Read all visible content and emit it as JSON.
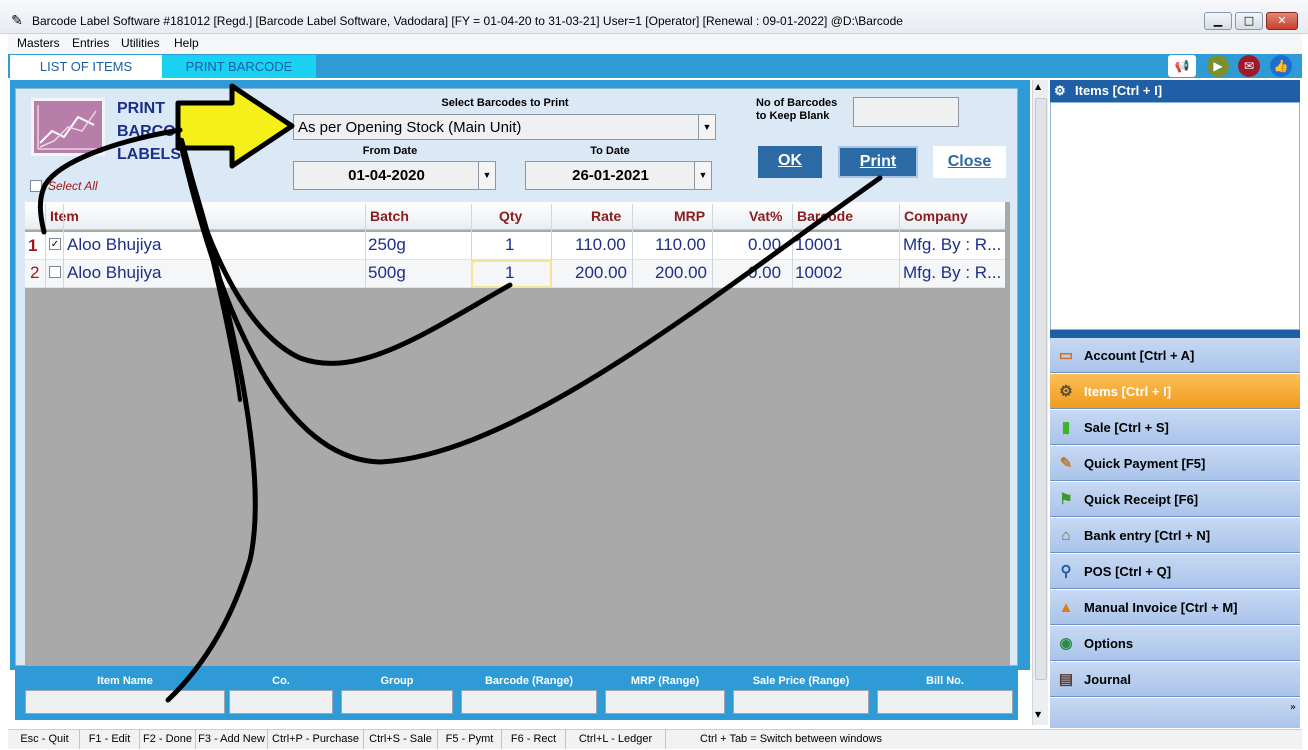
{
  "window": {
    "title": "Barcode Label Software #181012  [Regd.]  [Barcode Label Software, Vadodara] [FY = 01-04-20 to 31-03-21] User=1 [Operator]   [Renewal : 09-01-2022]  @D:\\Barcode"
  },
  "menu": [
    "Masters",
    "Entries",
    "Utilities",
    "Help"
  ],
  "tabs": {
    "list": "LIST OF ITEMS",
    "print": "PRINT BARCODE"
  },
  "panel": {
    "title_lines": [
      "PRINT",
      "BARCO",
      "LABELS"
    ],
    "select_label": "Select Barcodes to Print",
    "select_value": "As per Opening Stock (Main Unit)",
    "blank_label_1": "No of Barcodes",
    "blank_label_2": "to Keep Blank",
    "blank_value": "",
    "from_label": "From Date",
    "from_value": "01-04-2020",
    "to_label": "To Date",
    "to_value": "26-01-2021",
    "select_all": "Select All",
    "ok": "OK",
    "print": "Print",
    "close": "Close"
  },
  "grid": {
    "columns": [
      "Item",
      "Batch",
      "Qty",
      "Rate",
      "MRP",
      "Vat%",
      "Barcode",
      "Company"
    ],
    "rows": [
      {
        "no": "1",
        "checked": true,
        "item": "Aloo Bhujiya",
        "batch": "250g",
        "qty": "1",
        "rate": "110.00",
        "mrp": "110.00",
        "vat": "0.00",
        "barcode": "10001",
        "company": "Mfg. By : R..."
      },
      {
        "no": "2",
        "checked": false,
        "item": "Aloo Bhujiya",
        "batch": "500g",
        "qty": "1",
        "rate": "200.00",
        "mrp": "200.00",
        "vat": "0.00",
        "barcode": "10002",
        "company": "Mfg. By : R..."
      }
    ]
  },
  "filters": [
    "Item Name",
    "Co.",
    "Group",
    "Barcode (Range)",
    "MRP (Range)",
    "Sale Price (Range)",
    "Bill No."
  ],
  "right_panel": {
    "header": "Items [Ctrl + I]",
    "nav": [
      {
        "label": "Account [Ctrl + A]",
        "icon": "chat-icon"
      },
      {
        "label": "Items [Ctrl + I]",
        "icon": "items-icon",
        "active": true
      },
      {
        "label": "Sale [Ctrl + S]",
        "icon": "cylinder-icon"
      },
      {
        "label": "Quick Payment [F5]",
        "icon": "pen-icon"
      },
      {
        "label": "Quick Receipt [F6]",
        "icon": "flag-icon"
      },
      {
        "label": "Bank entry [Ctrl + N]",
        "icon": "bank-icon"
      },
      {
        "label": "POS [Ctrl + Q]",
        "icon": "pos-icon"
      },
      {
        "label": "Manual Invoice [Ctrl + M]",
        "icon": "cone-icon"
      },
      {
        "label": "Options",
        "icon": "globe-icon"
      },
      {
        "label": "Journal",
        "icon": "book-icon"
      }
    ]
  },
  "status": [
    "Esc - Quit",
    "F1 - Edit",
    "F2 - Done",
    "F3 - Add New",
    "Ctrl+P - Purchase",
    "Ctrl+S - Sale",
    "F5 - Pymt",
    "F6 - Rect",
    "Ctrl+L - Ledger",
    "Ctrl + Tab = Switch between windows"
  ]
}
